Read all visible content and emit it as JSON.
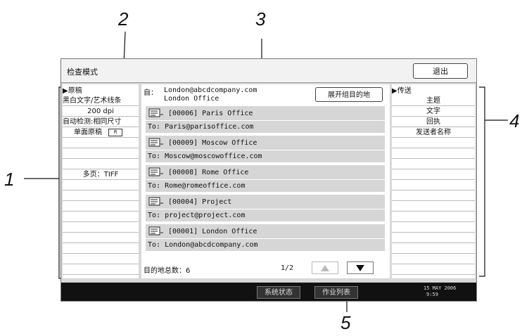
{
  "callouts": [
    "1",
    "2",
    "3",
    "4",
    "5"
  ],
  "screen": {
    "mode_title": "检查模式",
    "exit_label": "退出"
  },
  "left_panel": {
    "header": "▶原稿",
    "items": [
      "黑白文字/艺术线条",
      "200 dpi",
      "自动检测:相同尺寸",
      "单面原稿"
    ],
    "orientation_icon": "page-orientation-icon",
    "multipage": "多页：TIFF"
  },
  "center_panel": {
    "from_label": "自：",
    "from_email": "London@abcdcompany.com",
    "from_name": "London Office",
    "expand_label": "展开组目的地",
    "destinations": [
      {
        "name": "[00006] Paris Office",
        "to": "To: Paris@parisoffice.com"
      },
      {
        "name": "[00009] Moscow Office",
        "to": "To: Moscow@moscowoffice.com"
      },
      {
        "name": "[00008] Rome Office",
        "to": "To: Rome@romeoffice.com"
      },
      {
        "name": "[00004] Project",
        "to": "To: project@project.com"
      },
      {
        "name": "[00001] London Office",
        "to": "To: London@abcdcompany.com"
      }
    ],
    "total_label": "目的地总数：6",
    "page_indicator": "1/2",
    "prev_icon": "triangle-up-icon",
    "next_icon": "triangle-down-icon"
  },
  "right_panel": {
    "header": "▶传送",
    "items": [
      "主题",
      "文字",
      "回执",
      "发送者名称"
    ]
  },
  "bottom_bar": {
    "status_label": "系统状态",
    "queue_label": "作业列表",
    "date": "15 MAY  2006",
    "time": "9:59"
  }
}
